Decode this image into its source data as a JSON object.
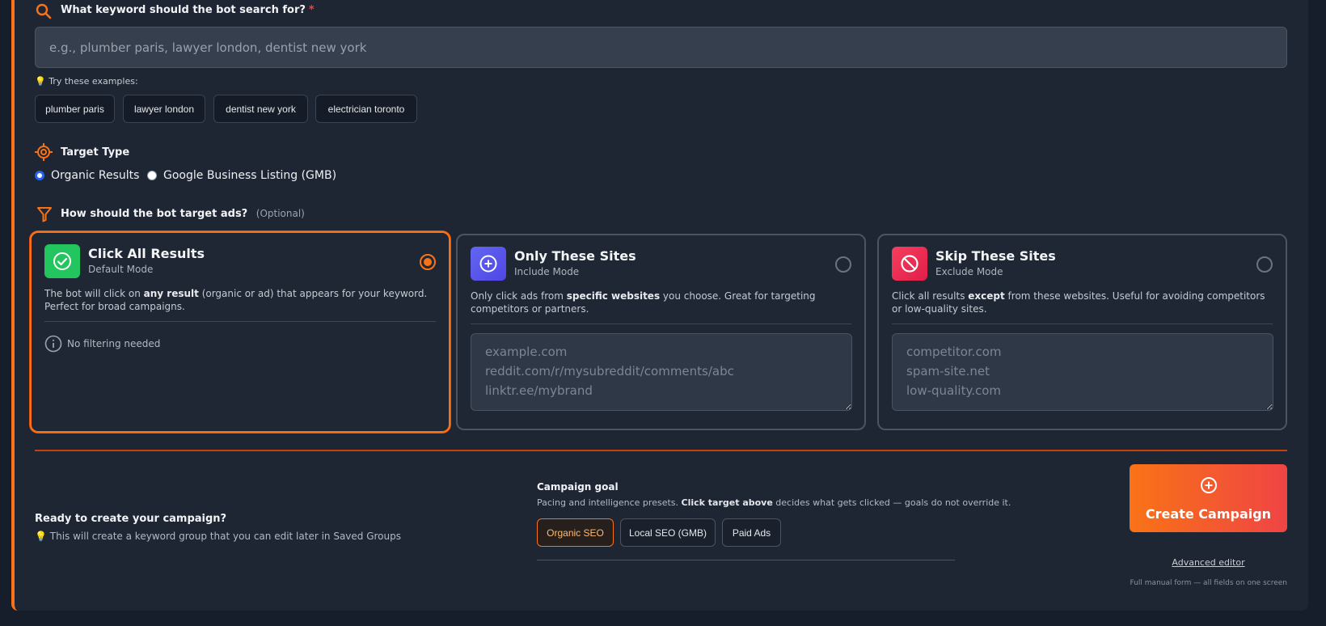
{
  "keyword": {
    "label": "What keyword should the bot search for?",
    "required_mark": "*",
    "placeholder": "e.g., plumber paris, lawyer london, dentist new york",
    "value": "",
    "examples_label": "💡 Try these examples:",
    "examples": [
      "plumber paris",
      "lawyer london",
      "dentist new york",
      "electrician toronto"
    ]
  },
  "target_type": {
    "label": "Target Type",
    "options": [
      "Organic Results",
      "Google Business Listing (GMB)"
    ],
    "selected": "Organic Results"
  },
  "ad_targeting": {
    "label": "How should the bot target ads?",
    "optional": "(Optional)",
    "cards": [
      {
        "title": "Click All Results",
        "subtitle": "Default Mode",
        "desc_pre": "The bot will click on ",
        "desc_bold": "any result",
        "desc_post": " (organic or ad) that appears for your keyword. Perfect for broad campaigns.",
        "note": "No filtering needed",
        "selected": true,
        "icon": "check-circle-icon",
        "icon_color": "#22c55e"
      },
      {
        "title": "Only These Sites",
        "subtitle": "Include Mode",
        "desc_pre": "Only click ads from ",
        "desc_bold": "specific websites",
        "desc_post": " you choose. Great for targeting competitors or partners.",
        "placeholder": "example.com\nreddit.com/r/mysubreddit/comments/abc\nlinktr.ee/mybrand",
        "selected": false,
        "icon": "plus-circle-icon",
        "icon_color": "#6366f1"
      },
      {
        "title": "Skip These Sites",
        "subtitle": "Exclude Mode",
        "desc_pre": "Click all results ",
        "desc_bold": "except",
        "desc_post": " from these websites. Useful for avoiding competitors or low-quality sites.",
        "placeholder": "competitor.com\nspam-site.net\nlow-quality.com",
        "selected": false,
        "icon": "block-icon",
        "icon_color": "#ef4444"
      }
    ]
  },
  "footer": {
    "ready_title": "Ready to create your campaign?",
    "ready_hint": "💡 This will create a keyword group that you can edit later in Saved Groups",
    "goal_label": "Campaign goal",
    "goal_desc_pre": "Pacing and intelligence presets. ",
    "goal_desc_bold": "Click target above",
    "goal_desc_post": " decides what gets clicked — goals do not override it.",
    "goals": [
      "Organic SEO",
      "Local SEO (GMB)",
      "Paid Ads"
    ],
    "selected_goal": "Organic SEO",
    "create_label": "Create Campaign",
    "advanced_link": "Advanced editor",
    "advanced_note": "Full manual form — all fields on one screen"
  },
  "colors": {
    "accent": "#f97316",
    "green": "#22c55e",
    "indigo": "#6366f1",
    "red": "#ef4444"
  }
}
